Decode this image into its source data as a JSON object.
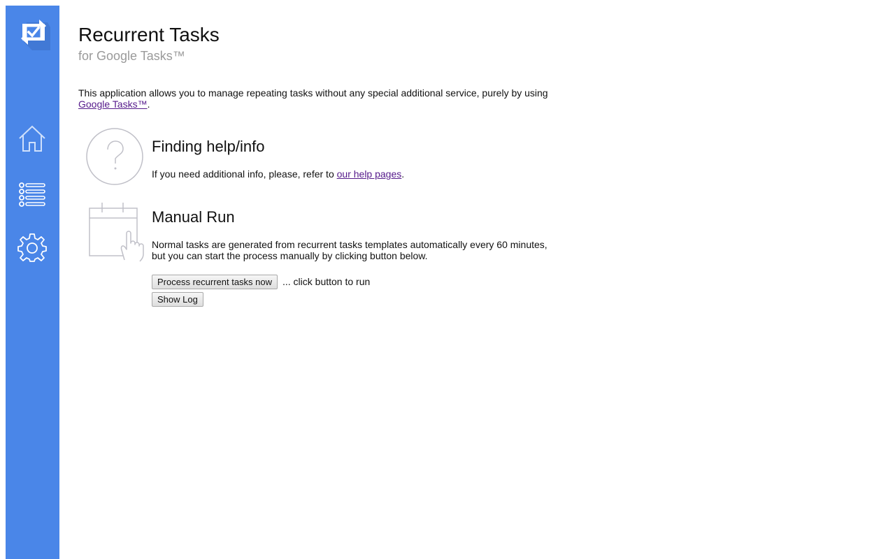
{
  "sidebar": {
    "logo_icon": "recurrent-check-logo-icon",
    "items": [
      {
        "icon": "home-icon",
        "label": "Home"
      },
      {
        "icon": "list-icon",
        "label": "Tasks"
      },
      {
        "icon": "gear-icon",
        "label": "Settings"
      }
    ],
    "color": "#4a86e8"
  },
  "header": {
    "title": "Recurrent Tasks",
    "subtitle": "for Google Tasks™"
  },
  "intro": {
    "text": "This application allows you to manage repeating tasks without any special additional service, purely by using ",
    "link_label": "Google Tasks™",
    "suffix": "."
  },
  "help_section": {
    "icon": "question-circle-icon",
    "title": "Finding help/info",
    "text_before": "If you need additional info, please, refer to ",
    "link_label": "our help pages",
    "text_after": "."
  },
  "manual_run": {
    "icon": "calendar-hand-icon",
    "title": "Manual Run",
    "line1": "Normal tasks are generated from recurrent tasks templates automatically every 60 minutes,",
    "line2": "but you can start the process manually by clicking button below.",
    "process_button_label": "Process recurrent tasks now",
    "hint": "... click button to run",
    "log_button_label": "Show Log"
  },
  "colors": {
    "link": "#551a8b",
    "subtitle": "#9a9a9a",
    "icon_outline": "#c0c0c8"
  }
}
